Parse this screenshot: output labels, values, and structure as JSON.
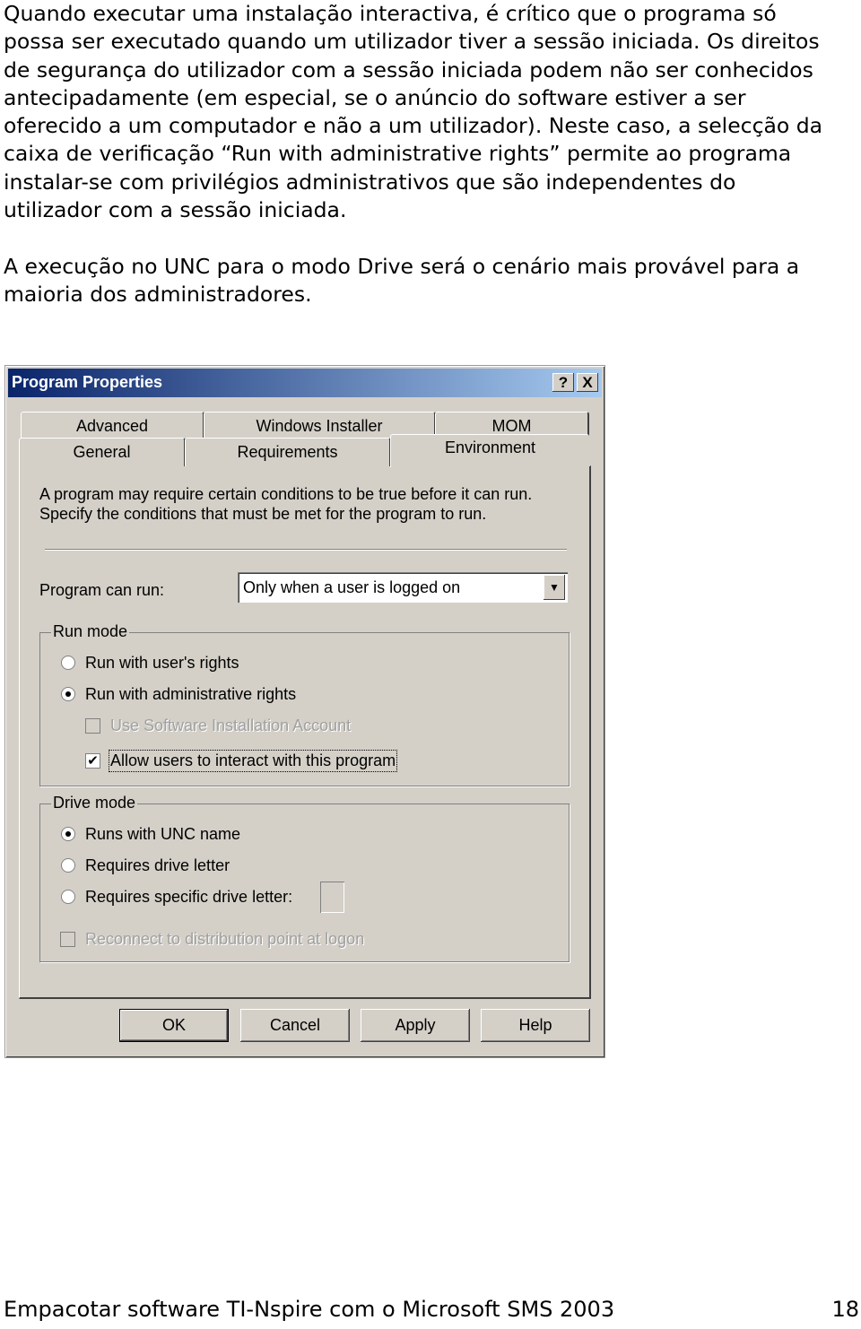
{
  "paragraphs": [
    {
      "lines": [
        "Quando executar uma instalação interactiva, é crítico que o programa só",
        "possa ser executado quando um utilizador tiver a sessão iniciada. Os direitos",
        "de segurança do utilizador com a sessão iniciada podem não ser conhecidos",
        "antecipadamente (em especial, se o anúncio do software estiver a ser",
        "oferecido a um computador e não a um utilizador). Neste caso, a selecção da",
        "caixa de verificação “Run with administrative rights” permite ao programa",
        "instalar-se com privilégios administrativos que são independentes do",
        "utilizador com a sessão iniciada."
      ]
    },
    {
      "lines": [
        "A execução no UNC para o modo Drive será o cenário mais provável para a",
        "maioria dos administradores."
      ]
    }
  ],
  "dialog": {
    "title": "Program Properties",
    "help_label": "?",
    "close_label": "X",
    "tabs_row1": [
      "Advanced",
      "Windows Installer",
      "MOM"
    ],
    "tabs_row2": [
      "General",
      "Requirements",
      "Environment"
    ],
    "active_tab": "Environment",
    "description": [
      "A program may require certain conditions to be true before it can run.",
      "Specify the conditions that must be met for the program to run."
    ],
    "program_can_run_label": "Program can run:",
    "program_can_run_value": "Only when a user is logged on",
    "run_mode": {
      "legend": "Run mode",
      "options": [
        {
          "label": "Run with user's rights",
          "selected": false
        },
        {
          "label": "Run with administrative rights",
          "selected": true
        }
      ],
      "checkboxes": [
        {
          "label": "Use Software Installation Account",
          "checked": false,
          "disabled": true
        },
        {
          "label": "Allow users to interact with this program",
          "checked": true,
          "disabled": false
        }
      ]
    },
    "drive_mode": {
      "legend": "Drive mode",
      "options": [
        {
          "label": "Runs with UNC name",
          "selected": true
        },
        {
          "label": "Requires drive letter",
          "selected": false
        },
        {
          "label": "Requires specific drive letter:",
          "selected": false
        }
      ],
      "reconnect": {
        "label": "Reconnect to distribution point at logon",
        "checked": false,
        "disabled": true
      }
    },
    "buttons": [
      "OK",
      "Cancel",
      "Apply",
      "Help"
    ]
  },
  "footer": {
    "title": "Empacotar software TI-Nspire com o Microsoft SMS 2003",
    "page": "18"
  }
}
